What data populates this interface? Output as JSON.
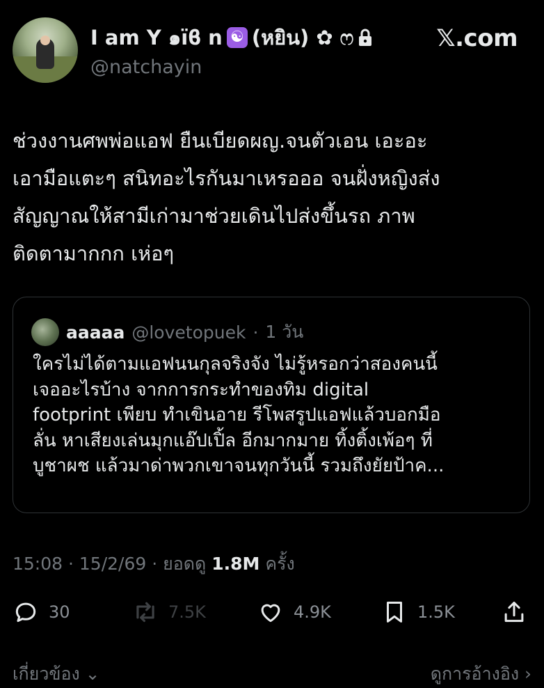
{
  "profile": {
    "display_name": "I am Y ๑ïϐ n",
    "name_suffix": "(หยิน) ✿ ෆ",
    "yinyang_symbol": "☯",
    "handle": "@natchayin",
    "icons": [
      "avatar-photo",
      "yin-yang-emoji",
      "lock-icon"
    ]
  },
  "brand": {
    "x": "𝕏",
    "domain": ".com"
  },
  "tweet": {
    "text": "ช่วงงานศพพ่อแอฟ ยืนเบียดผญ.จนตัวเอน เอะอะ\nเอามือแตะๆ สนิทอะไรกันมาเหรอออ จนฝั่งหญิงส่ง\nสัญญาณให้สามีเก่ามาช่วยเดินไปส่งขึ้นรถ ภาพ\nติดตามากกก เห่อๆ"
  },
  "quote": {
    "name": "aaaaa",
    "handle": "@lovetopuek",
    "separator": "·",
    "time": "1 วัน",
    "text": "ใครไม่ได้ตามแอฟนนกุลจริงจัง ไม่รู้หรอกว่าสองคนนี้\nเจออะไรบ้าง จากการกระทำของทิม  digital\nfootprint เพียบ ทำเขินอาย รีโพสรูปแอฟแล้วบอกมือ\nลั่น หาเสียงเล่นมุกแอ๊ปเปิ้ล อีกมากมาย ทิ้งติ้งเพ้อๆ ที่\nบูชาผช แล้วมาด่าพวกเขาจนทุกวันนี้ รวมถึงยัยป้าค..."
  },
  "meta": {
    "time": "15:08",
    "date": "15/2/69",
    "dot": "·",
    "views_label": "ยอดดู",
    "views_count": "1.8M",
    "views_suffix": "ครั้ง"
  },
  "actions": {
    "replies": "30",
    "reposts": "7.5K",
    "likes": "4.9K",
    "bookmarks": "1.5K"
  },
  "bottom": {
    "related": "เกี่ยวข้อง",
    "quotes": "ดูการอ้างอิง"
  },
  "colors": {
    "background": "#000000",
    "text": "#e7e9ea",
    "muted": "#71767b",
    "border": "#2f3336",
    "emoji_purple": "#9b5de5"
  }
}
